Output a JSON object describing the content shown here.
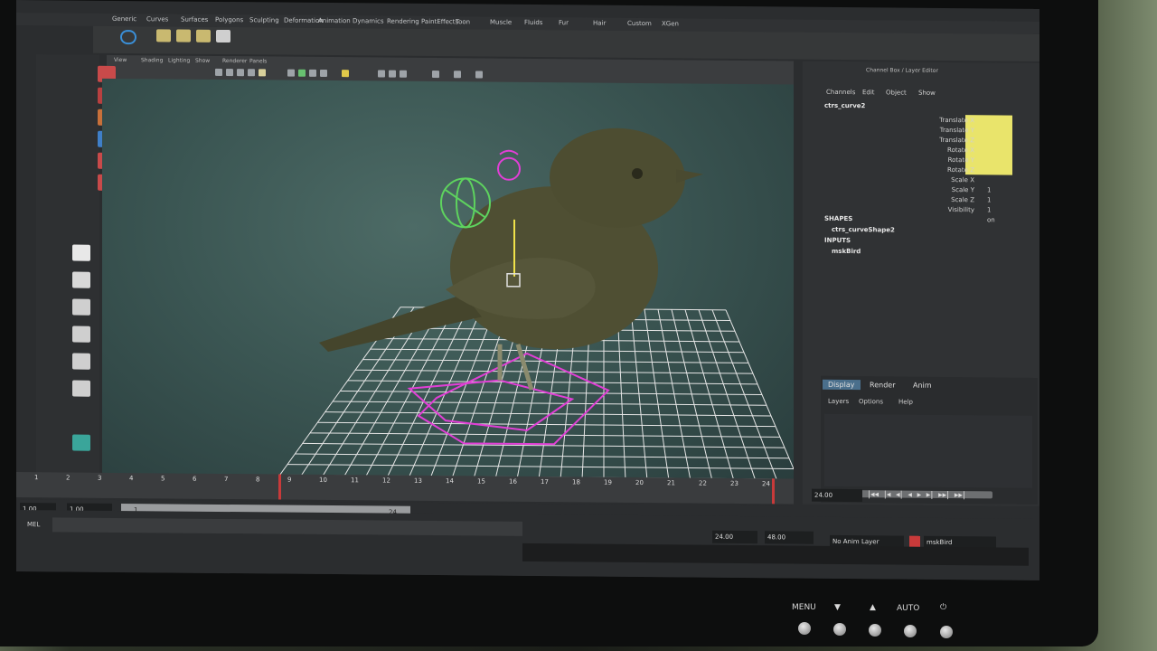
{
  "menubar": {
    "items": [
      "Generic",
      "Curves",
      "Surfaces",
      "Polygons",
      "Sculpting",
      "Deformation",
      "Animation",
      "Dynamics",
      "Rendering",
      "PaintEffects",
      "Toon",
      "Muscle",
      "Fluids",
      "Fur",
      "Hair",
      "Custom",
      "XGen"
    ]
  },
  "panel_menu": [
    "View",
    "Shading",
    "Lighting",
    "Show",
    "Renderer",
    "Panels"
  ],
  "channel_box": {
    "title": "Channel Box / Layer Editor",
    "menu": [
      "Channels",
      "Edit",
      "Object",
      "Show"
    ],
    "object": "ctrs_curve2",
    "attributes": [
      "Translate X",
      "Translate Y",
      "Translate Z",
      "Rotate X",
      "Rotate Y",
      "Rotate Z",
      "Scale X",
      "Scale Y",
      "Scale Z",
      "Visibility"
    ],
    "values": [
      "1",
      "1",
      "1",
      "on"
    ],
    "shapes_header": "SHAPES",
    "shape_name": "ctrs_curveShape2",
    "inputs_header": "INPUTS",
    "input_name": "mskBird"
  },
  "layer_editor": {
    "tabs": [
      "Display",
      "Render",
      "Anim"
    ],
    "menu": [
      "Layers",
      "Options",
      "Help"
    ]
  },
  "timeline": {
    "ticks": [
      "1",
      "2",
      "3",
      "4",
      "5",
      "6",
      "7",
      "8",
      "9",
      "10",
      "11",
      "12",
      "13",
      "14",
      "15",
      "16",
      "17",
      "18",
      "19",
      "20",
      "21",
      "22",
      "23",
      "24"
    ],
    "current_frame": "24.00",
    "start": "1.00",
    "start2": "1.00",
    "range_start": "1",
    "range_end": "24",
    "end": "24.00",
    "end2": "48.00"
  },
  "status": {
    "mel_label": "MEL",
    "anim_layer": "No Anim Layer",
    "character": "mskBird"
  },
  "monitor_buttons": {
    "menu": "MENU",
    "down": "▼",
    "up": "▲",
    "auto": "AUTO",
    "power": "⏻"
  },
  "colors": {
    "accent_tab": "#4a6f8c",
    "playhead": "#c83a3a",
    "highlight": "#e9e46b"
  }
}
